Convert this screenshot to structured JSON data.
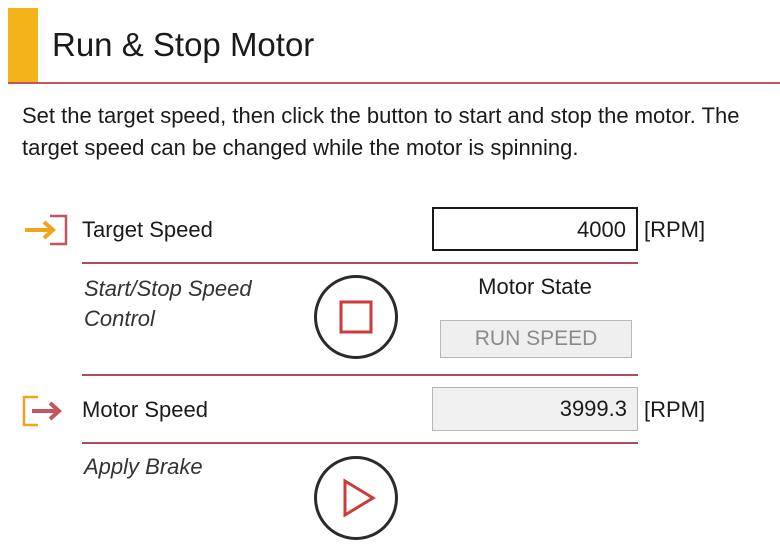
{
  "header": {
    "title": "Run & Stop Motor",
    "accent_color": "#f5b31a",
    "rule_color": "#c4555f"
  },
  "description": "Set the target speed, then click the button to start and stop the motor. The target speed can be changed while the motor is spinning.",
  "target_speed": {
    "label": "Target Speed",
    "value": "4000",
    "unit": "[RPM]",
    "icon": "input-arrow-icon"
  },
  "start_stop": {
    "label_line1": "Start/Stop Speed",
    "label_line2": "Control",
    "button_icon": "stop-square-icon"
  },
  "motor_state": {
    "label": "Motor State",
    "value": "RUN SPEED"
  },
  "motor_speed": {
    "label": "Motor Speed",
    "value": "3999.3",
    "unit": "[RPM]",
    "icon": "output-arrow-icon"
  },
  "brake": {
    "label": "Apply Brake",
    "button_icon": "play-triangle-icon"
  }
}
